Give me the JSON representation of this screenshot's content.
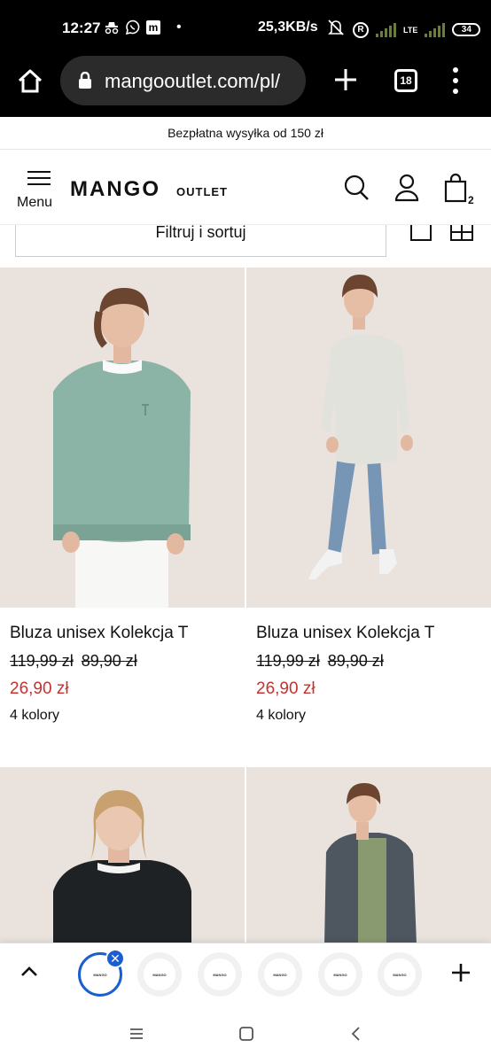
{
  "status_bar": {
    "time": "12:27",
    "speed": "25,3KB/s",
    "lte": "LTE",
    "battery": "34",
    "left_icons": [
      "incognito-icon",
      "viber-icon",
      "m-app-icon",
      "notification-dot"
    ],
    "right_icons": [
      "mute-icon",
      "r-icon",
      "signal-icon",
      "signal-icon",
      "battery-icon"
    ],
    "m_letter": "m",
    "r_letter": "R"
  },
  "browser": {
    "url": "mangooutlet.com/pl/",
    "tab_count": "18"
  },
  "promo": {
    "text": "Bezpłatna wysyłka od 150 zł"
  },
  "header": {
    "menu_label": "Menu",
    "logo": "MANGO",
    "logo_sub": "OUTLET",
    "bag_count": "2"
  },
  "filter": {
    "label": "Filtruj i sortuj"
  },
  "products": [
    {
      "name": "Bluza unisex Kolekcja T",
      "old_price_1": "119,99 zł",
      "old_price_2": "89,90 zł",
      "sale_price": "26,90 zł",
      "colors": "4 kolory",
      "sweater_color": "#8bb3a6"
    },
    {
      "name": "Bluza unisex Kolekcja T",
      "old_price_1": "119,99 zł",
      "old_price_2": "89,90 zł",
      "sale_price": "26,90 zł",
      "colors": "4 kolory",
      "sweater_color": "#e2e2dc"
    },
    {
      "sweater_color": "#1f2224"
    },
    {
      "sweater_color": "#4e5660"
    }
  ],
  "tab_strip": {
    "tab_thumb_label": "MANGO",
    "close_symbol": "✕"
  },
  "colors": {
    "sale_red": "#c6322f",
    "photo_bg": "#e9e2dd",
    "tab_active_blue": "#1a5fd0"
  }
}
